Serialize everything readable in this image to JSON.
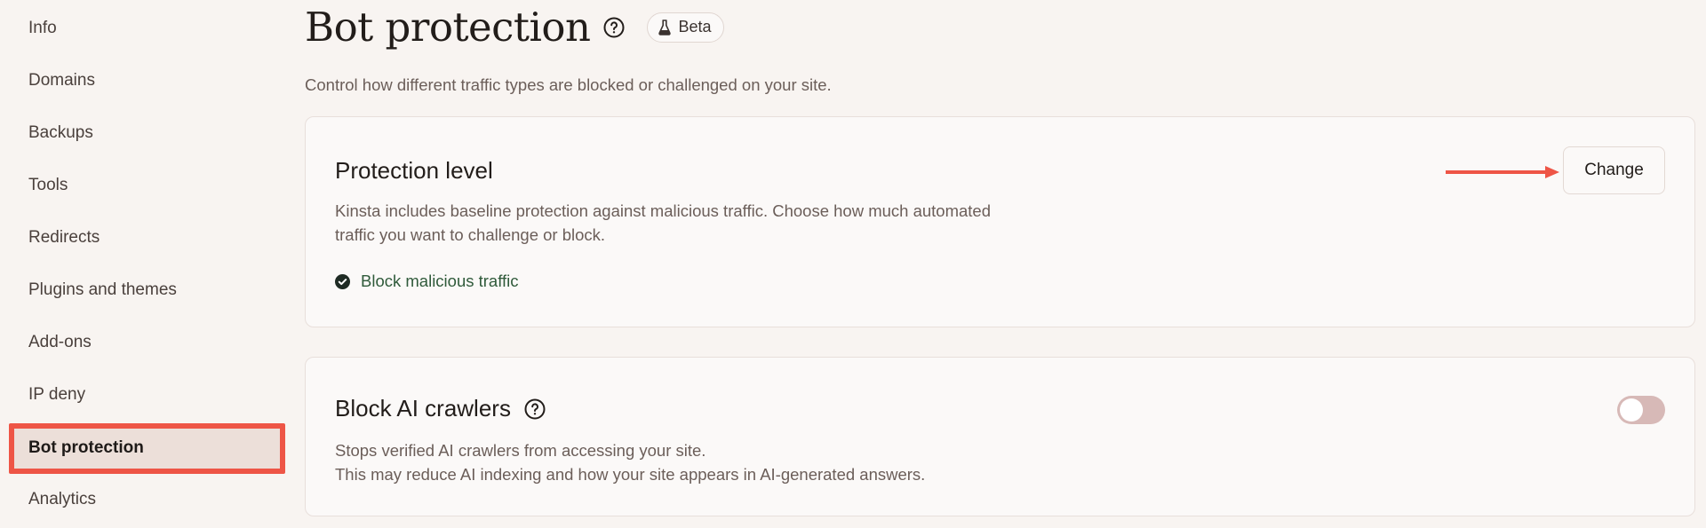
{
  "sidebar": {
    "items": [
      {
        "label": "Info"
      },
      {
        "label": "Domains"
      },
      {
        "label": "Backups"
      },
      {
        "label": "Tools"
      },
      {
        "label": "Redirects"
      },
      {
        "label": "Plugins and themes"
      },
      {
        "label": "Add-ons"
      },
      {
        "label": "IP deny"
      },
      {
        "label": "Bot protection",
        "active": true
      },
      {
        "label": "Analytics"
      }
    ]
  },
  "header": {
    "title": "Bot protection",
    "badge": "Beta",
    "subtitle": "Control how different traffic types are blocked or challenged on your site."
  },
  "protection_card": {
    "title": "Protection level",
    "description_line1": "Kinsta includes baseline protection against malicious traffic. Choose how much automated",
    "description_line2": "traffic you want to challenge or block.",
    "status": "Block malicious traffic",
    "change_label": "Change"
  },
  "ai_card": {
    "title": "Block AI crawlers",
    "description_line1": "Stops verified AI crawlers from accessing your site.",
    "description_line2": "This may reduce AI indexing and how your site appears in AI-generated answers.",
    "toggle_on": false
  },
  "colors": {
    "accent_highlight": "#ee5546",
    "active_nav_bg": "#ecdfd9",
    "status_green": "#2f5a3a",
    "toggle_off": "#d7b9b7"
  },
  "icons": [
    "help-circle-icon",
    "flask-icon",
    "check-circle-icon",
    "arrow-right-icon"
  ]
}
